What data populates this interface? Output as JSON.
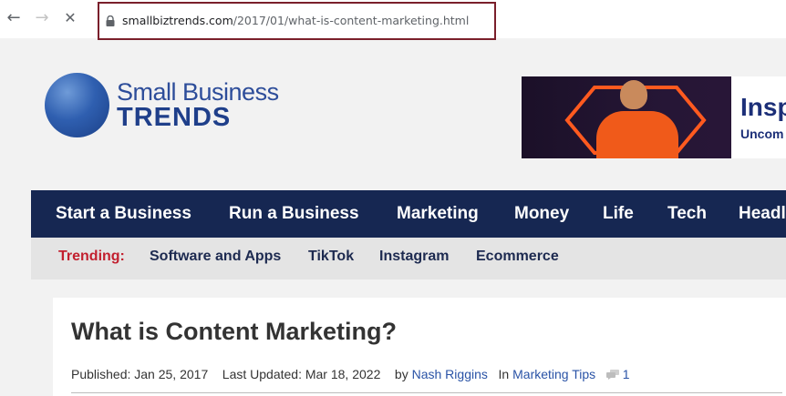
{
  "browser": {
    "back_icon": "←",
    "forward_icon": "→",
    "stop_icon": "✕",
    "url_host": "smallbiztrends.com",
    "url_path": "/2017/01/what-is-content-marketing.html"
  },
  "logo": {
    "line1": "Small Business",
    "line2": "TRENDS"
  },
  "ad": {
    "title": "Insp",
    "subtitle": "Uncom"
  },
  "nav": {
    "items": [
      "Start a Business",
      "Run a Business",
      "Marketing",
      "Money",
      "Life",
      "Tech",
      "Headl"
    ]
  },
  "trending": {
    "label": "Trending:",
    "items": [
      "Software and Apps",
      "TikTok",
      "Instagram",
      "Ecommerce"
    ]
  },
  "article": {
    "title": "What is Content Marketing?",
    "published_label": "Published: Jan 25, 2017",
    "updated_label": "Last Updated: Mar 18, 2022",
    "by_label": "by",
    "author": "Nash Riggins",
    "in_label": "In",
    "category": "Marketing Tips",
    "comment_count": "1"
  },
  "colors": {
    "nav_bg": "#162752",
    "trending_label": "#c21f2e",
    "omnibox_border": "#7a1f2b",
    "link": "#2a53a6"
  }
}
